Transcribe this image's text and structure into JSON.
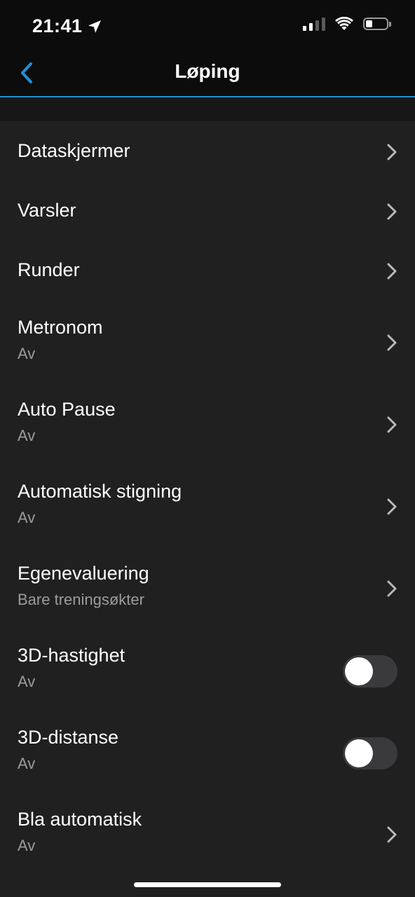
{
  "status_bar": {
    "time": "21:41",
    "location_icon": "location-arrow-icon",
    "signal_icon": "signal-bars-icon",
    "wifi_icon": "wifi-icon",
    "battery_icon": "battery-low-icon"
  },
  "nav": {
    "title": "Løping",
    "back_icon": "chevron-left-icon",
    "accent_color": "#1f8fd6"
  },
  "items": [
    {
      "label": "Dataskjermer",
      "sub": "",
      "control": "chevron"
    },
    {
      "label": "Varsler",
      "sub": "",
      "control": "chevron"
    },
    {
      "label": "Runder",
      "sub": "",
      "control": "chevron"
    },
    {
      "label": "Metronom",
      "sub": "Av",
      "control": "chevron"
    },
    {
      "label": "Auto Pause",
      "sub": "Av",
      "control": "chevron"
    },
    {
      "label": "Automatisk stigning",
      "sub": "Av",
      "control": "chevron"
    },
    {
      "label": "Egenevaluering",
      "sub": "Bare treningsøkter",
      "control": "chevron"
    },
    {
      "label": "3D-hastighet",
      "sub": "Av",
      "control": "toggle",
      "on": false
    },
    {
      "label": "3D-distanse",
      "sub": "Av",
      "control": "toggle",
      "on": false
    },
    {
      "label": "Bla automatisk",
      "sub": "Av",
      "control": "chevron"
    }
  ]
}
